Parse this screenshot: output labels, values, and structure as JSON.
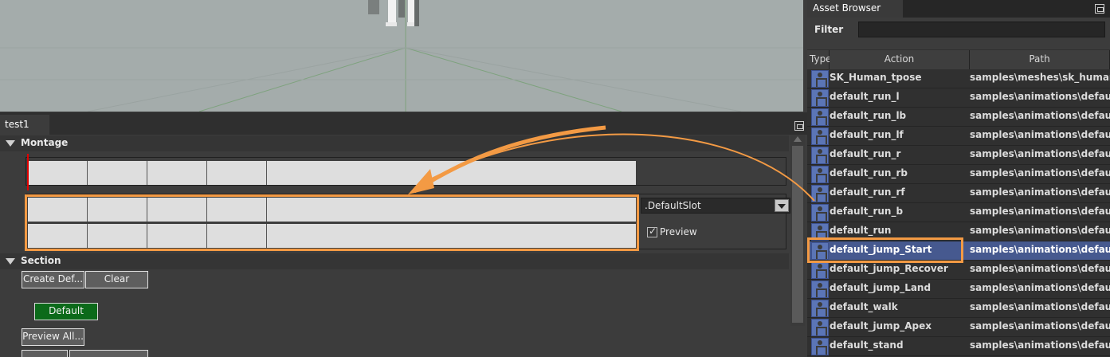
{
  "colors": {
    "accent_highlight": "#f39a44",
    "default_section_green": "#0c6a1a",
    "selected_row": "#46598f"
  },
  "montage_tab": {
    "title": "test1"
  },
  "montage_section": {
    "title": "Montage",
    "slot_value": ".DefaultSlot",
    "preview_label": "Preview",
    "preview_checked": true
  },
  "section_section": {
    "title": "Section",
    "create_default_button": "Create Def...",
    "clear_button": "Clear",
    "default_chip": "Default",
    "preview_all_button": "Preview All..."
  },
  "asset_browser": {
    "title": "Asset Browser",
    "filter_label": "Filter",
    "filter_value": "",
    "columns": {
      "type": "Type",
      "action": "Action",
      "path": "Path"
    },
    "items": [
      {
        "action": "SK_Human_tpose",
        "path": "samples\\meshes\\sk_human..."
      },
      {
        "action": "default_run_l",
        "path": "samples\\animations\\default..."
      },
      {
        "action": "default_run_lb",
        "path": "samples\\animations\\default..."
      },
      {
        "action": "default_run_lf",
        "path": "samples\\animations\\default..."
      },
      {
        "action": "default_run_r",
        "path": "samples\\animations\\default..."
      },
      {
        "action": "default_run_rb",
        "path": "samples\\animations\\default..."
      },
      {
        "action": "default_run_rf",
        "path": "samples\\animations\\default..."
      },
      {
        "action": "default_run_b",
        "path": "samples\\animations\\default..."
      },
      {
        "action": "default_run",
        "path": "samples\\animations\\default..."
      },
      {
        "action": "default_jump_Start",
        "path": "samples\\animations\\default..."
      },
      {
        "action": "default_jump_Recover",
        "path": "samples\\animations\\default..."
      },
      {
        "action": "default_jump_Land",
        "path": "samples\\animations\\default..."
      },
      {
        "action": "default_walk",
        "path": "samples\\animations\\default..."
      },
      {
        "action": "default_jump_Apex",
        "path": "samples\\animations\\default..."
      },
      {
        "action": "default_stand",
        "path": "samples\\animations\\default..."
      }
    ],
    "selected_action": "default_jump_Start"
  }
}
